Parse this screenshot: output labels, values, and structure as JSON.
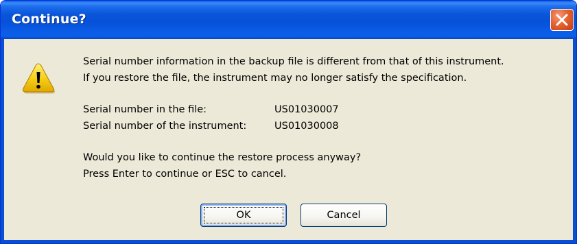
{
  "dialog": {
    "title": "Continue?",
    "close_icon": "close-icon",
    "warning_icon": "warning-icon",
    "message_line1": "Serial number information in the backup file is different from that of this instrument.",
    "message_line2": "If you restore the file, the instrument may no longer satisfy the specification.",
    "serial_file_label": "Serial number in the file:",
    "serial_file_value": "US01030007",
    "serial_instrument_label": "Serial number of the instrument:",
    "serial_instrument_value": "US01030008",
    "question_line1": "Would you like to continue the restore process anyway?",
    "question_line2": "Press Enter to continue or ESC to cancel.",
    "ok_label": "OK",
    "cancel_label": "Cancel"
  },
  "colors": {
    "titlebar": "#0a55d8",
    "dialog_bg": "#ece9d8",
    "close_button": "#e5632f",
    "warning_yellow": "#f7d117"
  }
}
